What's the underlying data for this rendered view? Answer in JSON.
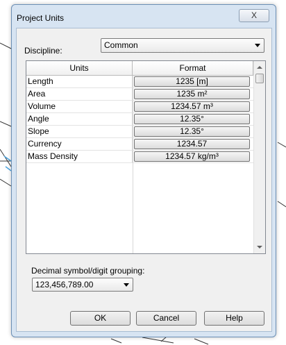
{
  "dialog": {
    "title": "Project Units",
    "close_label": "X"
  },
  "discipline": {
    "label": "Discipline:",
    "selected": "Common"
  },
  "grid": {
    "columns": [
      "Units",
      "Format"
    ],
    "rows": [
      {
        "unit": "Length",
        "format": "1235 [m]"
      },
      {
        "unit": "Area",
        "format": "1235 m²"
      },
      {
        "unit": "Volume",
        "format": "1234.57 m³"
      },
      {
        "unit": "Angle",
        "format": "12.35°"
      },
      {
        "unit": "Slope",
        "format": "12.35°"
      },
      {
        "unit": "Currency",
        "format": "1234.57"
      },
      {
        "unit": "Mass Density",
        "format": "1234.57 kg/m³"
      }
    ]
  },
  "decimal": {
    "label": "Decimal symbol/digit grouping:",
    "selected": "123,456,789.00"
  },
  "buttons": {
    "ok": "OK",
    "cancel": "Cancel",
    "help": "Help"
  },
  "icons": {
    "close": "close-icon",
    "dropdown": "chevron-down-icon",
    "scroll_up": "scroll-up-arrow-icon",
    "scroll_down": "scroll-down-arrow-icon"
  },
  "colors": {
    "frame": "#d7e4f2",
    "client": "#f0f0f0",
    "grid_bg": "#ffffff"
  }
}
